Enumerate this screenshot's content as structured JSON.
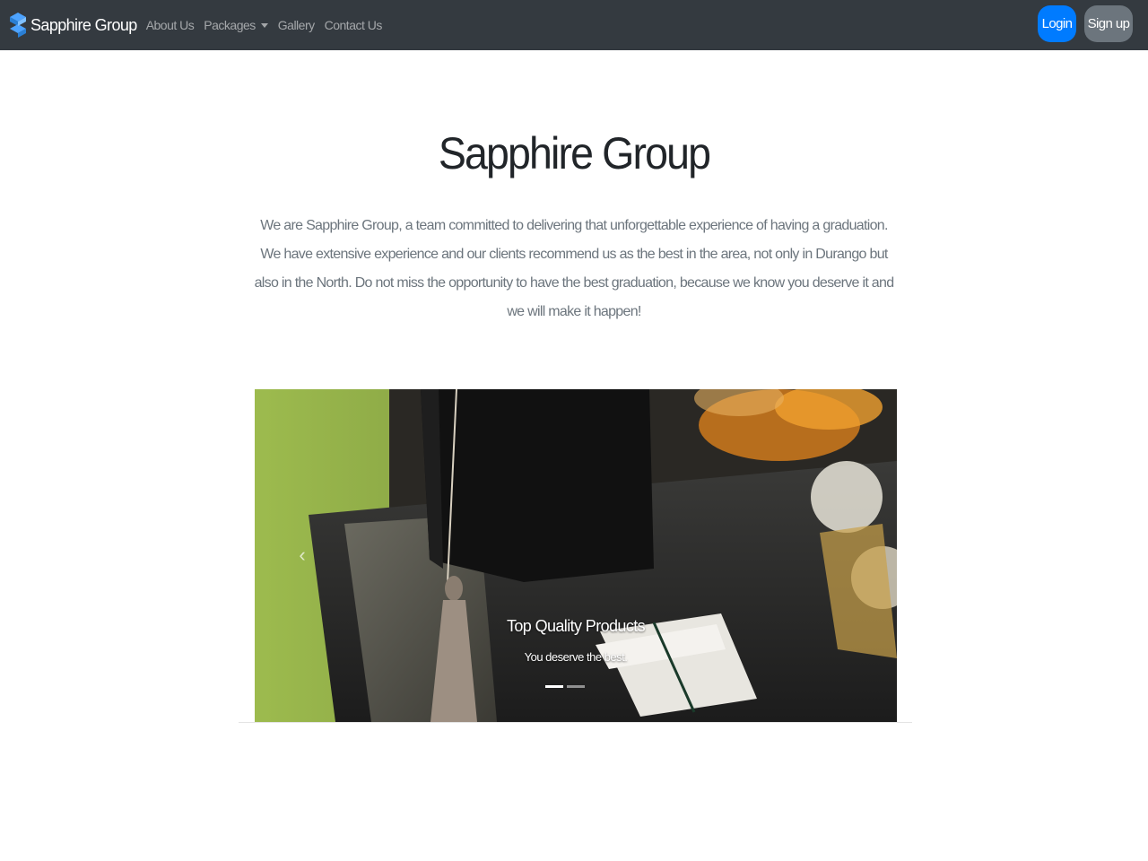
{
  "navbar": {
    "brand": "Sapphire Group",
    "logo_icon": "sapphire-s-logo-icon",
    "links": [
      {
        "label": "About Us"
      },
      {
        "label": "Packages",
        "has_dropdown": true
      },
      {
        "label": "Gallery"
      },
      {
        "label": "Contact Us"
      }
    ],
    "login_label": "Login",
    "signup_label": "Sign up"
  },
  "hero": {
    "title": "Sapphire Group",
    "lead": "We are Sapphire Group, a team committed to delivering that unforgettable experience of having a graduation. We have extensive experience and our clients recommend us as the best in the area, not only in Durango but also in the North. Do not miss the opportunity to have the best graduation, because we know you deserve it and we will make it happen!"
  },
  "carousel": {
    "image_alt_icon": "graduation-cap-photo",
    "caption_title": "Top Quality Products",
    "caption_text": "You deserve the best.",
    "slide_count": 2,
    "active_slide": 1,
    "prev_icon": "chevron-left-icon",
    "next_icon": "chevron-right-icon"
  },
  "colors": {
    "navbar_bg": "#343a40",
    "primary": "#007bff",
    "secondary": "#6c757d"
  }
}
